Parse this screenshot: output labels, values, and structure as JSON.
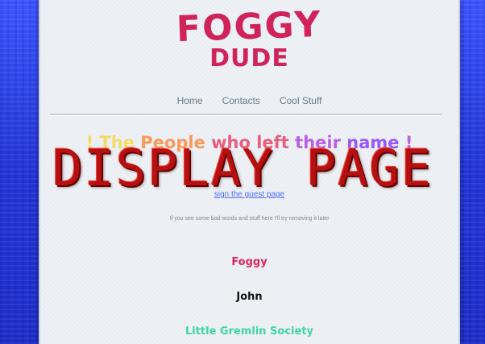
{
  "logo": {
    "line1": "FOGGY",
    "line2": "DUDE",
    "color": "#d0235a"
  },
  "nav": {
    "items": [
      {
        "label": "Home"
      },
      {
        "label": "Contacts"
      },
      {
        "label": "Cool Stuff"
      }
    ]
  },
  "heading": {
    "segments": [
      {
        "text": "! The ",
        "color": "#f6d84a"
      },
      {
        "text": "People ",
        "color": "#ff8a3d"
      },
      {
        "text": "who ",
        "color": "#e8456a"
      },
      {
        "text": "left ",
        "color": "#e8456a"
      },
      {
        "text": "their ",
        "color": "#b447e0"
      },
      {
        "text": "name",
        "color": "#8a3dff"
      },
      {
        "text": " !",
        "color": "#b447e0"
      }
    ]
  },
  "overlay": {
    "text": "DISPLAY PAGE",
    "color": "#b51012"
  },
  "link": {
    "text": "sign the guest page"
  },
  "notice": {
    "text": "If you see some bad words and stuff here I'll try removing it later"
  },
  "names": [
    {
      "name": "Foggy",
      "color": "#e3245e"
    },
    {
      "name": "John",
      "color": "#111111"
    },
    {
      "name": "Little Gremlin Society",
      "color": "#3fd6a4"
    }
  ],
  "colors": {
    "page_bg": "#eef2f7",
    "outer_bg": "#2a3fe0",
    "nav_text": "#6b7a8a"
  }
}
